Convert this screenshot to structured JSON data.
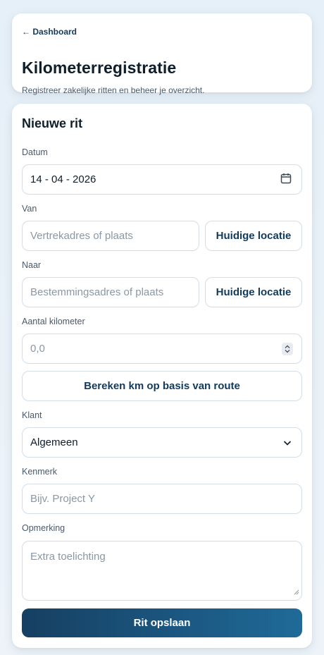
{
  "header": {
    "back_link": "← Dashboard",
    "title": "Kilometerregistratie",
    "subtitle": "Registreer zakelijke ritten en beheer je overzicht."
  },
  "form": {
    "title": "Nieuwe rit",
    "date": {
      "label": "Datum",
      "value": "14 - 04 - 2026",
      "icon": "calendar-icon"
    },
    "from": {
      "label": "Van",
      "placeholder": "Vertrekadres of plaats",
      "location_button": "Huidige locatie"
    },
    "to": {
      "label": "Naar",
      "placeholder": "Bestemmingsadres of plaats",
      "location_button": "Huidige locatie"
    },
    "km": {
      "label": "Aantal kilometer",
      "placeholder": "0,0"
    },
    "calc_button": "Bereken km op basis van route",
    "client": {
      "label": "Klant",
      "selected": "Algemeen"
    },
    "reference": {
      "label": "Kenmerk",
      "placeholder": "Bijv. Project Y"
    },
    "note": {
      "label": "Opmerking",
      "placeholder": "Extra toelichting"
    },
    "submit": "Rit opslaan"
  },
  "colors": {
    "accent_dark": "#163f62",
    "accent_light": "#1f6a99",
    "link": "#123a5c"
  }
}
